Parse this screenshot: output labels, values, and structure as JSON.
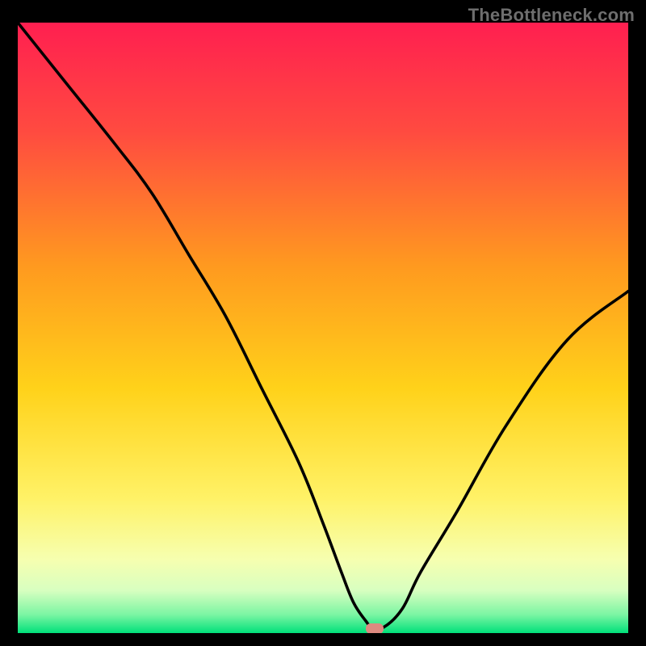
{
  "watermark": "TheBottleneck.com",
  "colors": {
    "frame_black": "#000000",
    "gradient_stops": [
      {
        "offset": 0.0,
        "color": "#ff1f50"
      },
      {
        "offset": 0.18,
        "color": "#ff4b40"
      },
      {
        "offset": 0.4,
        "color": "#ff9a1f"
      },
      {
        "offset": 0.6,
        "color": "#ffd21a"
      },
      {
        "offset": 0.78,
        "color": "#fff267"
      },
      {
        "offset": 0.88,
        "color": "#f6ffb0"
      },
      {
        "offset": 0.93,
        "color": "#d8ffc0"
      },
      {
        "offset": 0.97,
        "color": "#7bf5a3"
      },
      {
        "offset": 1.0,
        "color": "#00e07a"
      }
    ],
    "curve": "#000000",
    "marker": "#dd8a80"
  },
  "chart_data": {
    "type": "line",
    "title": "",
    "xlabel": "",
    "ylabel": "",
    "xlim": [
      0,
      100
    ],
    "ylim": [
      0,
      100
    ],
    "series": [
      {
        "name": "bottleneck-curve",
        "x": [
          0,
          8,
          16,
          22,
          28,
          34,
          40,
          46,
          50,
          53,
          55,
          57,
          58,
          60,
          63,
          66,
          72,
          80,
          90,
          100
        ],
        "y": [
          100,
          90,
          80,
          72,
          62,
          52,
          40,
          28,
          18,
          10,
          5,
          2,
          1,
          1,
          4,
          10,
          20,
          34,
          48,
          56
        ]
      }
    ],
    "marker": {
      "x_pct": 58.5,
      "y_pct": 0.8
    },
    "grid": false,
    "legend": false
  }
}
